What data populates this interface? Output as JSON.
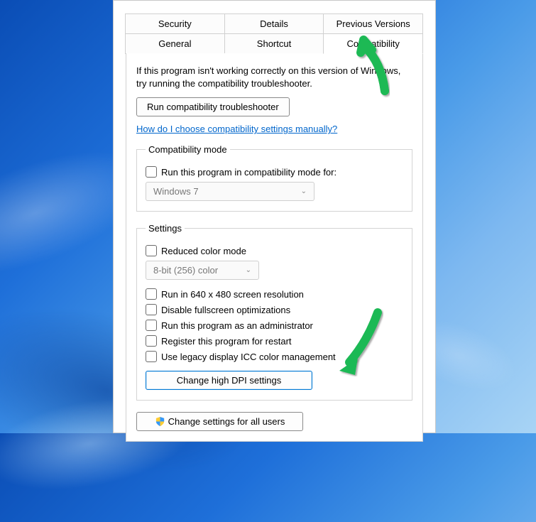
{
  "tabs": {
    "row1": [
      "Security",
      "Details",
      "Previous Versions"
    ],
    "row2": [
      "General",
      "Shortcut",
      "Compatibility"
    ],
    "active": "Compatibility"
  },
  "intro": "If this program isn't working correctly on this version of Windows, try running the compatibility troubleshooter.",
  "troubleshooter_btn": "Run compatibility troubleshooter",
  "help_link": "How do I choose compatibility settings manually?",
  "compat_group": {
    "legend": "Compatibility mode",
    "checkbox_label": "Run this program in compatibility mode for:",
    "select_value": "Windows 7"
  },
  "settings_group": {
    "legend": "Settings",
    "reduced_color": "Reduced color mode",
    "color_select": "8-bit (256) color",
    "run_640": "Run in 640 x 480 screen resolution",
    "disable_fullscreen": "Disable fullscreen optimizations",
    "run_admin": "Run this program as an administrator",
    "register_restart": "Register this program for restart",
    "legacy_icc": "Use legacy display ICC color management",
    "dpi_btn": "Change high DPI settings"
  },
  "all_users_btn": "Change settings for all users"
}
